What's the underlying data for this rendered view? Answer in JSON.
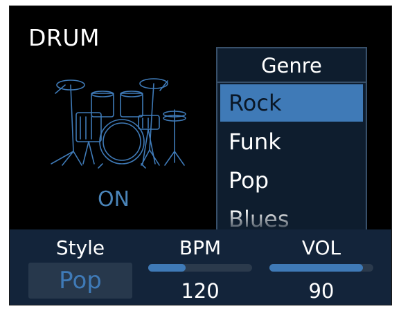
{
  "app": {
    "title": "DRUM",
    "status": "ON"
  },
  "genre": {
    "header": "Genre",
    "items": [
      {
        "label": "Rock",
        "selected": true
      },
      {
        "label": "Funk",
        "selected": false
      },
      {
        "label": "Pop",
        "selected": false
      },
      {
        "label": "Blues",
        "selected": false
      }
    ]
  },
  "controls": {
    "style": {
      "label": "Style",
      "value": "Pop"
    },
    "bpm": {
      "label": "BPM",
      "value": "120",
      "level": 0.36
    },
    "vol": {
      "label": "VOL",
      "value": "90",
      "level": 0.9
    }
  },
  "colors": {
    "accent": "#3f7ab7",
    "panel": "#13243a",
    "screen": "#000000"
  },
  "icons": {
    "drum": "drum-kit-icon"
  }
}
